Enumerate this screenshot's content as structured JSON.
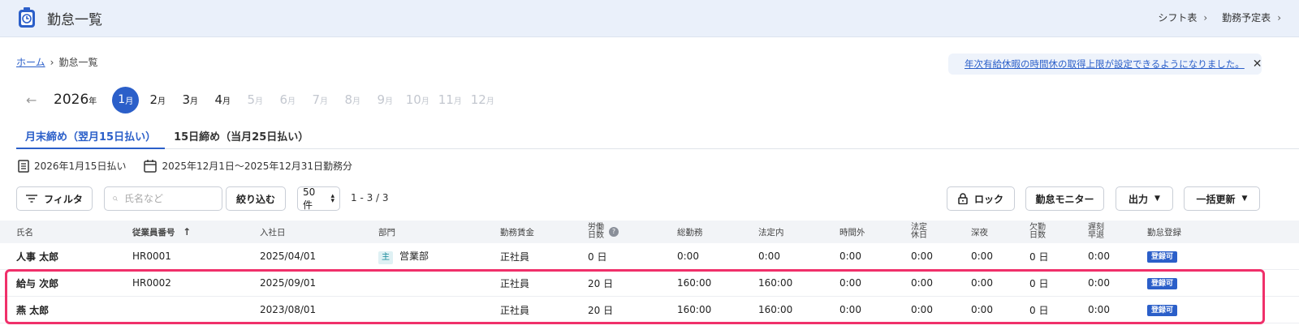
{
  "header": {
    "title": "勤怠一覧",
    "links": [
      {
        "label": "シフト表"
      },
      {
        "label": "勤務予定表"
      }
    ]
  },
  "breadcrumb": {
    "home": "ホーム",
    "current": "勤怠一覧"
  },
  "notice": {
    "text": "年次有給休暇の時間休の取得上限が設定できるようになりました。"
  },
  "months": {
    "year": "2026",
    "year_unit": "年",
    "month_unit": "月",
    "items": [
      "1",
      "2",
      "3",
      "4",
      "5",
      "6",
      "7",
      "8",
      "9",
      "10",
      "11",
      "12"
    ],
    "active_index": 0,
    "enabled_count": 4
  },
  "tabs": [
    {
      "label": "月末締め（翌月15日払い）",
      "active": true
    },
    {
      "label": "15日締め（当月25日払い）",
      "active": false
    }
  ],
  "period": {
    "payday": "2026年1月15日払い",
    "range": "2025年12月1日〜2025年12月31日勤務分"
  },
  "toolbar": {
    "filter_label": "フィルタ",
    "search_placeholder": "氏名など",
    "narrow_label": "絞り込む",
    "per_page": "50件",
    "count": "1 - 3 / 3",
    "lock_label": "ロック",
    "monitor_label": "勤怠モニター",
    "output_label": "出力",
    "bulk_label": "一括更新"
  },
  "table": {
    "headers": {
      "name": "氏名",
      "emp_no": "従業員番号",
      "hire_date": "入社日",
      "dept": "部門",
      "wage": "勤務賃金",
      "workdays_1": "労働",
      "workdays_2": "日数",
      "total": "総勤務",
      "legal": "法定内",
      "overtime": "時間外",
      "holiday_1": "法定",
      "holiday_2": "休日",
      "night": "深夜",
      "absence_1": "欠勤",
      "absence_2": "日数",
      "late_1": "遅刻",
      "late_2": "早退",
      "register": "勤怠登録"
    },
    "rows": [
      {
        "name": "人事 太郎",
        "emp_no": "HR0001",
        "hire_date": "2025/04/01",
        "dept_badge": "主",
        "dept": "営業部",
        "wage": "正社員",
        "workdays": "0 日",
        "total": "0:00",
        "legal": "0:00",
        "overtime": "0:00",
        "holiday": "0:00",
        "night": "0:00",
        "absence": "0 日",
        "late": "0:00",
        "register": "登録可"
      },
      {
        "name": "給与 次郎",
        "emp_no": "HR0002",
        "hire_date": "2025/09/01",
        "dept_badge": "",
        "dept": "",
        "wage": "正社員",
        "workdays": "20 日",
        "total": "160:00",
        "legal": "160:00",
        "overtime": "0:00",
        "holiday": "0:00",
        "night": "0:00",
        "absence": "0 日",
        "late": "0:00",
        "register": "登録可"
      },
      {
        "name": "燕 太郎",
        "emp_no": "",
        "hire_date": "2023/08/01",
        "dept_badge": "",
        "dept": "",
        "wage": "正社員",
        "workdays": "20 日",
        "total": "160:00",
        "legal": "160:00",
        "overtime": "0:00",
        "holiday": "0:00",
        "night": "0:00",
        "absence": "0 日",
        "late": "0:00",
        "register": "登録可"
      }
    ]
  },
  "colors": {
    "accent": "#2b5fc9",
    "highlight": "#f0306a"
  }
}
